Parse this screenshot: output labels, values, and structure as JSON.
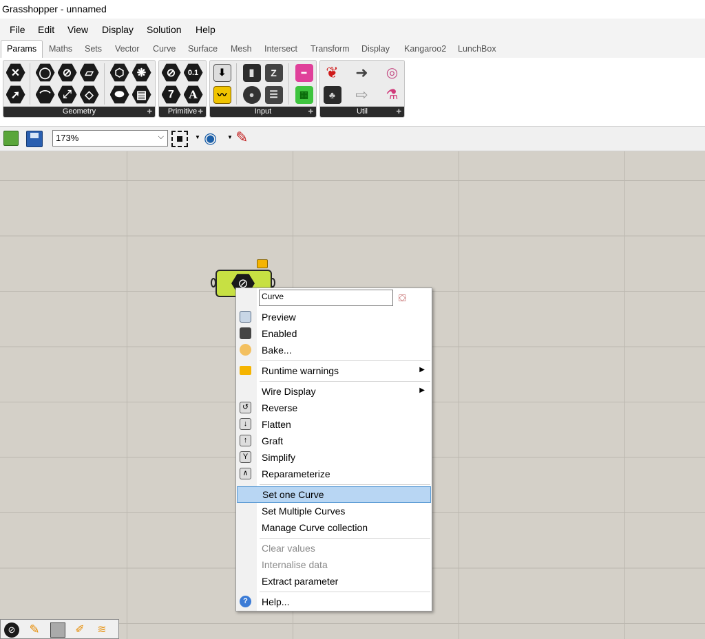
{
  "window": {
    "title": "Grasshopper - unnamed"
  },
  "menu": [
    "File",
    "Edit",
    "View",
    "Display",
    "Solution",
    "Help"
  ],
  "tabs": [
    "Params",
    "Maths",
    "Sets",
    "Vector",
    "Curve",
    "Surface",
    "Mesh",
    "Intersect",
    "Transform",
    "Display",
    "Kangaroo2",
    "LunchBox"
  ],
  "ribbon": {
    "groups": [
      "Geometry",
      "Primitive",
      "Input",
      "Util"
    ],
    "primitive_icons": [
      "0.1",
      "7",
      "A"
    ]
  },
  "toolbar": {
    "zoom_value": "173%",
    "zoom_arrow": "⌵"
  },
  "context_menu": {
    "name_value": "Curve",
    "items": [
      "Preview",
      "Enabled",
      "Bake...",
      "Runtime warnings",
      "Wire Display",
      "Reverse",
      "Flatten",
      "Graft",
      "Simplify",
      "Reparameterize",
      "Set one Curve",
      "Set Multiple Curves",
      "Manage Curve collection",
      "Clear values",
      "Internalise data",
      "Extract parameter",
      "Help..."
    ],
    "highlighted": "Set one Curve",
    "submenu_arrow": "▶"
  },
  "colors": {
    "canvas": "#d4d0c8",
    "component_fill": "#c7e043",
    "highlight": "#b8d6f3",
    "ribbon_label_bg": "#2b2b2b"
  }
}
